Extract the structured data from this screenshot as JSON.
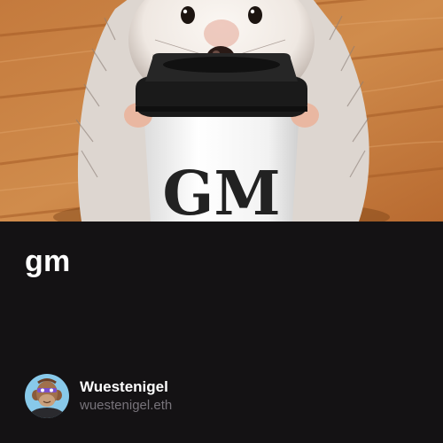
{
  "post": {
    "image_alt": "Hedgehog holding a coffee cup",
    "cup_text": "GM",
    "title": "gm"
  },
  "author": {
    "name": "Wuestenigel",
    "handle": "wuestenigel.eth"
  },
  "colors": {
    "background": "#141214",
    "title": "#ffffff",
    "handle": "#77737a"
  }
}
